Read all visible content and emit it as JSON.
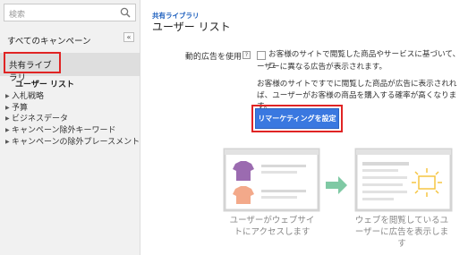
{
  "sidebar": {
    "search_placeholder": "検索",
    "all_campaigns": "すべてのキャンペーン",
    "collapse_glyph": "«",
    "shared_library": "共有ライブラリ",
    "items": [
      {
        "label": "ユーザー リスト",
        "active": true
      },
      {
        "label": "入札戦略",
        "active": false
      },
      {
        "label": "予算",
        "active": false
      },
      {
        "label": "ビジネスデータ",
        "active": false
      },
      {
        "label": "キャンペーン除外キーワード",
        "active": false
      },
      {
        "label": "キャンペーンの除外プレースメント",
        "active": false
      }
    ],
    "arrow_glyph": "▶"
  },
  "main": {
    "breadcrumb": "共有ライブラリ",
    "title": "ユーザー リスト",
    "field_label": "動的広告を使用",
    "help_glyph": "?",
    "description_line1": "お客様のサイトで閲覧した商品やサービスに基づいて、ユ",
    "description_line2": "ーザーに異なる広告が表示されます。",
    "description2": "お客様のサイトですでに閲覧した商品が広告に表示されれば、ユーザーがお客様の商品を購入する確率が高くなります。",
    "remarketing_button": "リマーケティングを設定",
    "caption_left": "ユーザーがウェブサイトにアクセスします",
    "caption_right": "ウェブを閲覧しているユーザーに広告を表示します"
  },
  "colors": {
    "highlight": "#e02424",
    "button": "#3a78e0",
    "arrow": "#7fc9a4",
    "shirt_purple": "#9b6bb0",
    "shirt_orange": "#f3a98a",
    "sparkle": "#f5c542"
  }
}
